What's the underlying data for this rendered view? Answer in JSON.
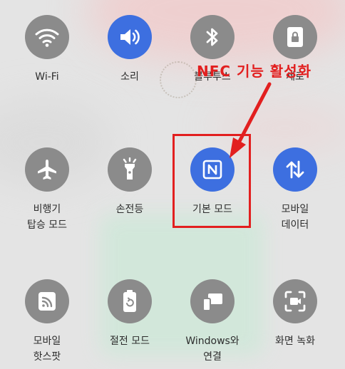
{
  "tiles": [
    {
      "label": "Wi-Fi",
      "icon": "wifi-icon",
      "state": "off"
    },
    {
      "label": "소리",
      "icon": "sound-icon",
      "state": "on"
    },
    {
      "label": "블루투스",
      "icon": "bluetooth-icon",
      "state": "off"
    },
    {
      "label": "세로",
      "icon": "portrait-lock-icon",
      "state": "off"
    },
    {
      "label": "비행기\n탑승 모드",
      "icon": "airplane-icon",
      "state": "off"
    },
    {
      "label": "손전등",
      "icon": "flashlight-icon",
      "state": "off"
    },
    {
      "label": "기본 모드",
      "icon": "nfc-icon",
      "state": "on"
    },
    {
      "label": "모바일\n데이터",
      "icon": "mobile-data-icon",
      "state": "on"
    },
    {
      "label": "모바일\n핫스팟",
      "icon": "hotspot-icon",
      "state": "off"
    },
    {
      "label": "절전 모드",
      "icon": "battery-saver-icon",
      "state": "off"
    },
    {
      "label": "Windows와\n연결",
      "icon": "link-to-windows-icon",
      "state": "off"
    },
    {
      "label": "화면 녹화",
      "icon": "screen-recorder-icon",
      "state": "off"
    }
  ],
  "annotation": {
    "text": "NFC 기능 활성화",
    "color": "#e21f1f"
  },
  "colors": {
    "active": "#3d6fe0",
    "inactive": "#8b8b8b",
    "highlight": "#e21f1f"
  }
}
